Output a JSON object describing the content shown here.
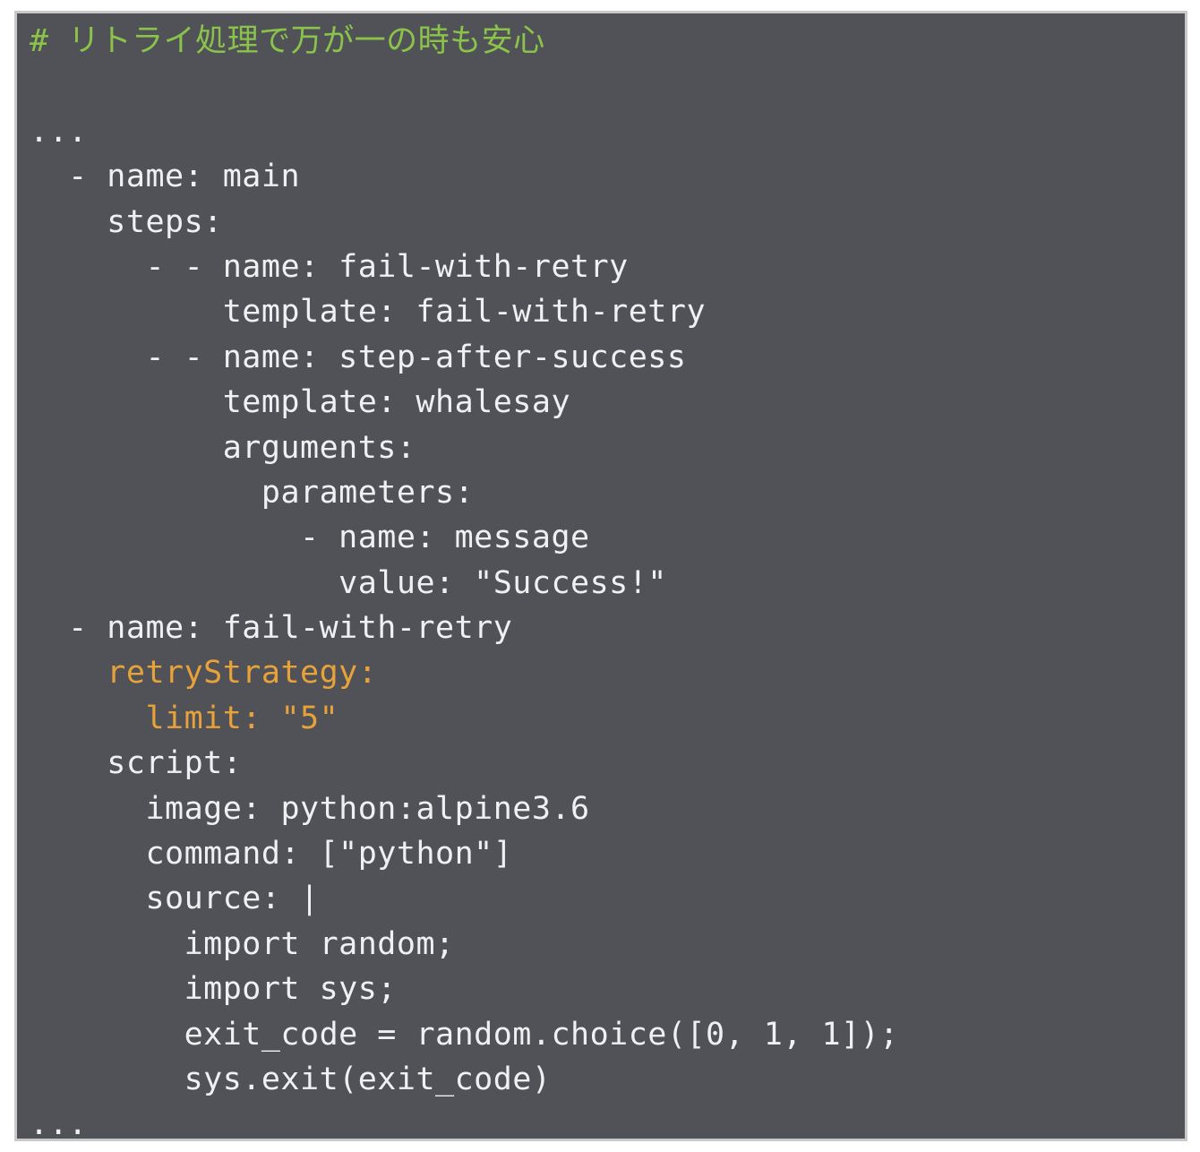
{
  "code_view": {
    "lines": [
      {
        "indent": "",
        "text": "# リトライ処理で万が一の時も安心",
        "kind": "comment"
      },
      {
        "indent": "",
        "text": "",
        "kind": "plain"
      },
      {
        "indent": "",
        "text": "...",
        "kind": "plain"
      },
      {
        "indent": "  ",
        "text": "- name: main",
        "kind": "plain"
      },
      {
        "indent": "    ",
        "text": "steps:",
        "kind": "plain"
      },
      {
        "indent": "      ",
        "text": "- - name: fail-with-retry",
        "kind": "plain"
      },
      {
        "indent": "          ",
        "text": "template: fail-with-retry",
        "kind": "plain"
      },
      {
        "indent": "      ",
        "text": "- - name: step-after-success",
        "kind": "plain"
      },
      {
        "indent": "          ",
        "text": "template: whalesay",
        "kind": "plain"
      },
      {
        "indent": "          ",
        "text": "arguments:",
        "kind": "plain"
      },
      {
        "indent": "            ",
        "text": "parameters:",
        "kind": "plain"
      },
      {
        "indent": "              ",
        "text": "- name: message",
        "kind": "plain"
      },
      {
        "indent": "                ",
        "text": "value: \"Success!\"",
        "kind": "plain"
      },
      {
        "indent": "  ",
        "text": "- name: fail-with-retry",
        "kind": "plain"
      },
      {
        "indent": "    ",
        "text": "retryStrategy:",
        "kind": "highlight"
      },
      {
        "indent": "      ",
        "text": "limit: \"5\"",
        "kind": "highlight"
      },
      {
        "indent": "    ",
        "text": "script:",
        "kind": "plain"
      },
      {
        "indent": "      ",
        "text": "image: python:alpine3.6",
        "kind": "plain"
      },
      {
        "indent": "      ",
        "text": "command: [\"python\"]",
        "kind": "plain"
      },
      {
        "indent": "      ",
        "text": "source: |",
        "kind": "plain"
      },
      {
        "indent": "        ",
        "text": "import random;",
        "kind": "plain"
      },
      {
        "indent": "        ",
        "text": "import sys;",
        "kind": "plain"
      },
      {
        "indent": "        ",
        "text": "exit_code = random.choice([0, 1, 1]);",
        "kind": "plain"
      },
      {
        "indent": "        ",
        "text": "sys.exit(exit_code)",
        "kind": "plain"
      },
      {
        "indent": "",
        "text": "...",
        "kind": "plain"
      }
    ]
  },
  "colors": {
    "background": "#505257",
    "text": "#eef0f2",
    "comment": "#8bc34a",
    "highlight": "#e8a23a"
  }
}
